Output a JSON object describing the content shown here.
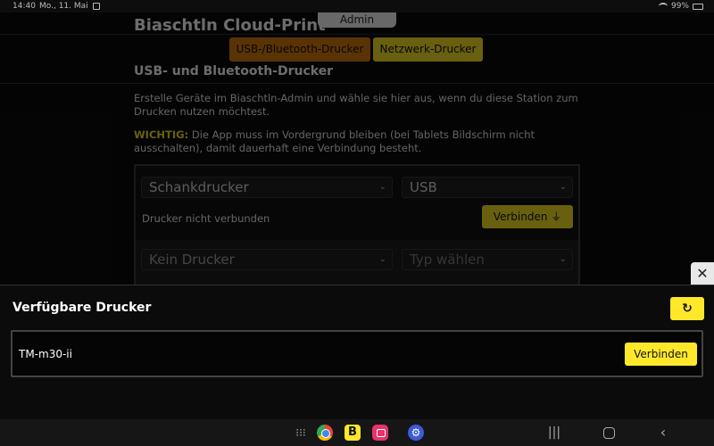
{
  "status_bar": {
    "time": "14:40",
    "date": "Mo., 11. Mai",
    "battery": "99%"
  },
  "app": {
    "title": "Biaschtln Cloud-Print",
    "admin_label": "Admin",
    "tabs": [
      {
        "label": "USB-/Bluetooth-Drucker"
      },
      {
        "label": "Netzwerk-Drucker"
      }
    ],
    "section_title": "USB- und Bluetooth-Drucker",
    "description": "Erstelle Geräte im Biaschtln-Admin und wähle sie hier aus, wenn du diese Station zum Drucken nutzen möchtest.",
    "warning_label": "WICHTIG:",
    "warning_text": " Die App muss im Vordergrund bleiben (bei Tablets Bildschirm nicht ausschalten), damit dauerhaft eine Verbindung besteht.",
    "printer_rows": [
      {
        "device": "Schankdrucker",
        "type": "USB",
        "status": "Drucker nicht verbunden",
        "connect_label": "Verbinden ⏚"
      },
      {
        "device": "Kein Drucker",
        "type": "Typ wählen"
      }
    ]
  },
  "sheet": {
    "title": "Verfügbare Drucker",
    "close_glyph": "✕",
    "refresh_glyph": "↻",
    "printers": [
      {
        "name": "TM-m30-ii",
        "connect_label": "Verbinden"
      }
    ]
  },
  "navbar": {
    "apps_glyph": "⁝⁝⁝",
    "b_app_label": "B",
    "settings_glyph": "⚙",
    "recent_glyph": "|||",
    "back_glyph": "‹"
  },
  "colors": {
    "accent_yellow": "#ffe82a",
    "tab_orange": "#c8720c",
    "background": "#000000"
  },
  "icons": [
    "image-icon",
    "wifi-icon",
    "battery-icon",
    "close-icon",
    "refresh-icon",
    "chevron-down-icon",
    "usb-icon",
    "apps-grid-icon",
    "chrome-icon",
    "camera-icon",
    "settings-icon",
    "recent-apps-icon",
    "home-icon",
    "back-icon"
  ]
}
